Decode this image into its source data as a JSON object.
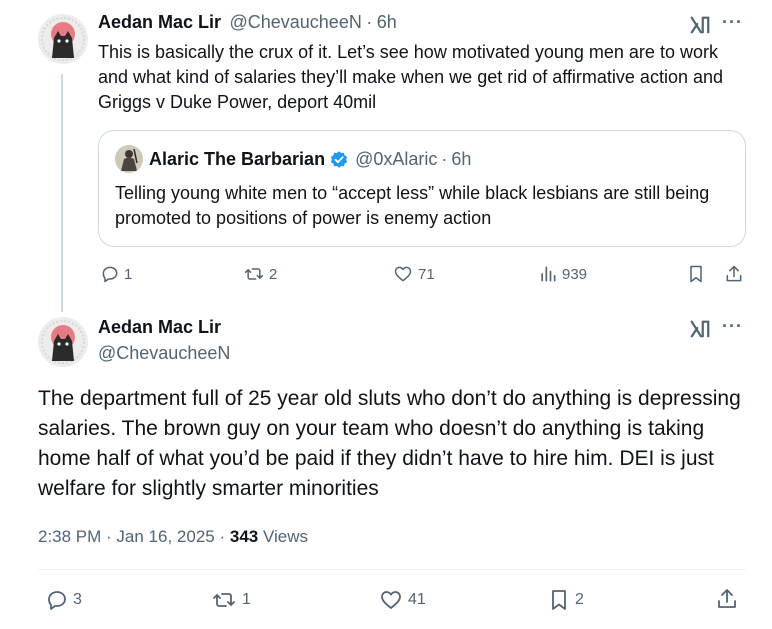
{
  "reply_tweet": {
    "author_name": "Aedan Mac Lir",
    "author_handle": "@ChevaucheeN",
    "separator": "·",
    "time": "6h",
    "text": "This is basically the crux of it. Let’s see how motivated young men are to work and what kind of salaries they’ll make when we get rid of affirmative action and Griggs v Duke Power, deport 40mil",
    "quote": {
      "author_name": "Alaric The Barbarian",
      "author_handle": "@0xAlaric",
      "separator": "·",
      "time": "6h",
      "text": "Telling young white men to “accept less” while black lesbians are still being promoted to positions of power is enemy action"
    },
    "actions": {
      "replies": "1",
      "reposts": "2",
      "likes": "71",
      "views": "939"
    }
  },
  "main_tweet": {
    "author_name": "Aedan Mac Lir",
    "author_handle": "@ChevaucheeN",
    "text": "The department full of 25 year old sluts who don’t do anything is depressing salaries. The brown guy on your team who doesn’t do anything is taking home half of what you’d be paid if they didn’t have to hire him. DEI is just welfare for slightly smarter minorities",
    "timestamp": "2:38 PM · Jan 16, 2025",
    "meta_separator": "·",
    "views_count": "343",
    "views_label": "Views",
    "actions": {
      "replies": "3",
      "reposts": "1",
      "likes": "41",
      "bookmarks": "2"
    }
  },
  "icons": {
    "more": "more-horizontal-icon",
    "grok": "grok-icon",
    "verified": "verified-badge-icon",
    "reply": "reply-icon",
    "repost": "repost-icon",
    "like": "heart-icon",
    "views": "views-chart-icon",
    "bookmark": "bookmark-icon",
    "share": "share-icon"
  },
  "colors": {
    "text": "#0f1419",
    "secondary": "#536471",
    "border": "#cfd9de",
    "verified": "#1d9bf0"
  }
}
